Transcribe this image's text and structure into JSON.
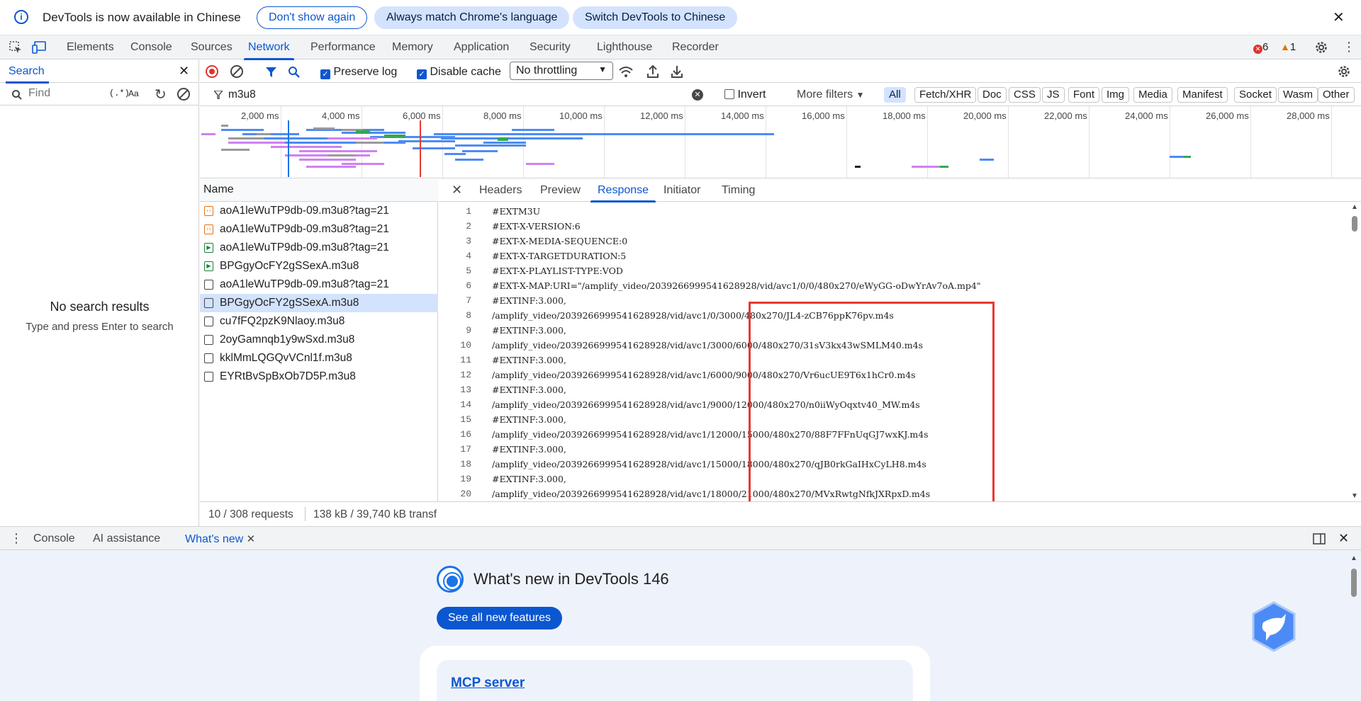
{
  "infobar": {
    "message": "DevTools is now available in Chinese",
    "dont_show": "Don't show again",
    "always_match": "Always match Chrome's language",
    "switch": "Switch DevTools to Chinese"
  },
  "main_tabs": [
    "Elements",
    "Console",
    "Sources",
    "Network",
    "Performance",
    "Memory",
    "Application",
    "Security",
    "Lighthouse",
    "Recorder"
  ],
  "active_main_tab": "Network",
  "issues": {
    "errors": "6",
    "warnings": "1"
  },
  "search": {
    "tab_label": "Search",
    "find_placeholder": "Find",
    "regex_label": "(.*)",
    "case_label": "Aa",
    "no_results": "No search results",
    "hint": "Type and press Enter to search"
  },
  "toolbar": {
    "preserve_log": "Preserve log",
    "disable_cache": "Disable cache",
    "throttling": "No throttling"
  },
  "filter": {
    "value": "m3u8",
    "invert": "Invert",
    "more_filters": "More filters",
    "types": [
      "All",
      "Fetch/XHR",
      "Doc",
      "CSS",
      "JS",
      "Font",
      "Img",
      "Media",
      "Manifest",
      "Socket",
      "Wasm",
      "Other"
    ]
  },
  "timeline": {
    "ticks": [
      "2,000 ms",
      "4,000 ms",
      "6,000 ms",
      "8,000 ms",
      "10,000 ms",
      "12,000 ms",
      "14,000 ms",
      "16,000 ms",
      "18,000 ms",
      "20,000 ms",
      "22,000 ms",
      "24,000 ms",
      "26,000 ms",
      "28,000 ms"
    ]
  },
  "requests": {
    "column_name": "Name",
    "items": [
      {
        "name": "aoA1leWuTP9db-09.m3u8?tag=21",
        "icon": "code-file-icon"
      },
      {
        "name": "aoA1leWuTP9db-09.m3u8?tag=21",
        "icon": "code-file-icon"
      },
      {
        "name": "aoA1leWuTP9db-09.m3u8?tag=21",
        "icon": "media-file-icon"
      },
      {
        "name": "BPGgyOcFY2gSSexA.m3u8",
        "icon": "media-file-icon"
      },
      {
        "name": "aoA1leWuTP9db-09.m3u8?tag=21",
        "icon": "document-icon"
      },
      {
        "name": "BPGgyOcFY2gSSexA.m3u8",
        "icon": "document-icon"
      },
      {
        "name": "cu7fFQ2pzK9Nlaoy.m3u8",
        "icon": "document-icon"
      },
      {
        "name": "2oyGamnqb1y9wSxd.m3u8",
        "icon": "document-icon"
      },
      {
        "name": "kklMmLQGQvVCnl1f.m3u8",
        "icon": "document-icon"
      },
      {
        "name": "EYRtBvSpBxOb7D5P.m3u8",
        "icon": "document-icon"
      }
    ],
    "selected_index": 5
  },
  "detail": {
    "tabs": [
      "Headers",
      "Preview",
      "Response",
      "Initiator",
      "Timing"
    ],
    "active_tab": "Response",
    "lines": [
      "#EXTM3U",
      "#EXT-X-VERSION:6",
      "#EXT-X-MEDIA-SEQUENCE:0",
      "#EXT-X-TARGETDURATION:5",
      "#EXT-X-PLAYLIST-TYPE:VOD",
      "#EXT-X-MAP:URI=\"/amplify_video/2039266999541628928/vid/avc1/0/0/480x270/eWyGG-oDwYrAv7oA.mp4\"",
      "#EXTINF:3.000,",
      "/amplify_video/2039266999541628928/vid/avc1/0/3000/480x270/JL4-zCB76ppK76pv.m4s",
      "#EXTINF:3.000,",
      "/amplify_video/2039266999541628928/vid/avc1/3000/6000/480x270/31sV3kx43wSMLM40.m4s",
      "#EXTINF:3.000,",
      "/amplify_video/2039266999541628928/vid/avc1/6000/9000/480x270/Vr6ucUE9T6x1hCr0.m4s",
      "#EXTINF:3.000,",
      "/amplify_video/2039266999541628928/vid/avc1/9000/12000/480x270/n0iiWyOqxtv40_MW.m4s",
      "#EXTINF:3.000,",
      "/amplify_video/2039266999541628928/vid/avc1/12000/15000/480x270/88F7FFnUqGJ7wxKJ.m4s",
      "#EXTINF:3.000,",
      "/amplify_video/2039266999541628928/vid/avc1/15000/18000/480x270/qJB0rkGaIHxCyLH8.m4s",
      "#EXTINF:3.000,",
      "/amplify_video/2039266999541628928/vid/avc1/18000/21000/480x270/MVxRwtgNfkJXRpxD.m4s"
    ]
  },
  "status": {
    "requests": "10 / 308 requests",
    "transferred": "138 kB / 39,740 kB transf"
  },
  "drawer": {
    "tabs": [
      "Console",
      "AI assistance",
      "What's new"
    ],
    "active_tab": "What's new",
    "title": "What's new in DevTools 146",
    "see_all": "See all new features",
    "card_link": "MCP server"
  },
  "colors": {
    "accent": "#0b57d0",
    "selection": "#d3e3fd",
    "highlight_box": "#e53935",
    "error": "#dc362e",
    "warning": "#e37400"
  }
}
